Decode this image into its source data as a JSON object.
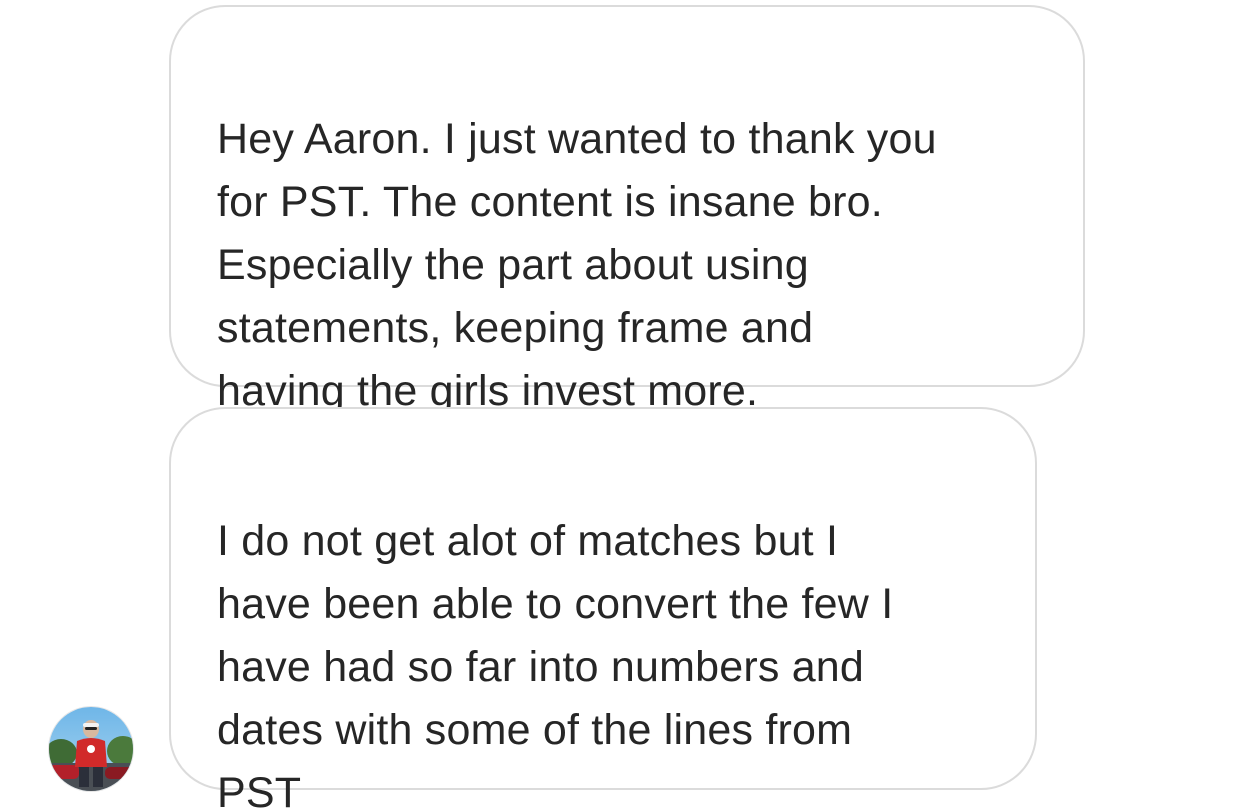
{
  "conversation": {
    "messages": [
      {
        "sender": "contact",
        "text": "Hey Aaron. I just wanted to thank you\nfor PST. The content is insane bro.\nEspecially the part about using\nstatements, keeping frame and\nhaving the girls invest more."
      },
      {
        "sender": "contact",
        "text": "I do not get alot of matches but I\nhave been able to convert the few I\nhave had so far into numbers and\ndates with some of the lines from\nPST"
      }
    ],
    "avatar": {
      "icon": "contact-avatar-icon"
    }
  },
  "colors": {
    "bubble_border": "#dbdbdb",
    "text": "#262626",
    "background": "#ffffff"
  }
}
